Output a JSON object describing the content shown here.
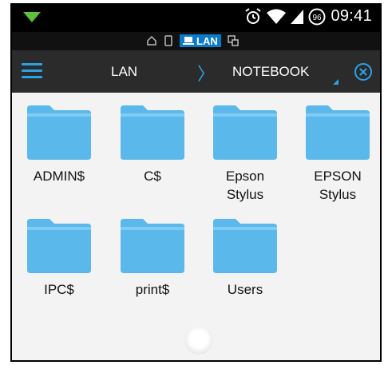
{
  "status_bar": {
    "time": "09:41",
    "battery_level": "96",
    "icons": [
      "download-icon",
      "alarm-icon",
      "wifi-icon",
      "signal-icon",
      "battery-icon"
    ]
  },
  "tabs": [
    {
      "icon": "home-icon"
    },
    {
      "icon": "phone-icon"
    },
    {
      "icon": "laptop-icon",
      "label": "LAN",
      "active": true
    },
    {
      "icon": "devices-icon"
    }
  ],
  "toolbar": {
    "breadcrumb": [
      "LAN",
      "NOTEBOOK"
    ],
    "separator": "〉",
    "accent_color": "#2aa3e6"
  },
  "folders": [
    {
      "name": "ADMIN$"
    },
    {
      "name": "C$"
    },
    {
      "name": "Epson Stylus"
    },
    {
      "name": "EPSON Stylus"
    },
    {
      "name": "IPC$"
    },
    {
      "name": "print$"
    },
    {
      "name": "Users"
    }
  ],
  "colors": {
    "folder": "#5bb8ea",
    "folder_tab": "#80ccf2",
    "background": "#f3f3f3",
    "action_bar": "#2b2b2b"
  }
}
